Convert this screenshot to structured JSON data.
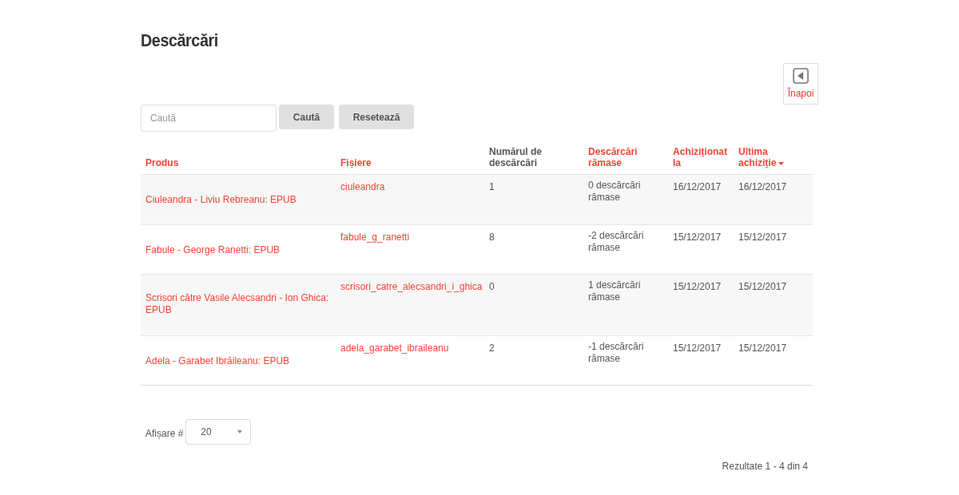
{
  "title": "Descărcări",
  "back_button": {
    "label": "Înapoi"
  },
  "search": {
    "placeholder": "Caută",
    "buttons": [
      "Caută",
      "Resetează"
    ]
  },
  "table": {
    "columns": [
      {
        "label": "Produs",
        "sortable": true,
        "sorted": false
      },
      {
        "label": "Fișiere",
        "sortable": true,
        "sorted": false
      },
      {
        "label": "Numărul de descărcări",
        "sortable": false,
        "sorted": false
      },
      {
        "label": "Descărcări rămase",
        "sortable": true,
        "sorted": false
      },
      {
        "label": "Achiziționat la",
        "sortable": true,
        "sorted": false
      },
      {
        "label": "Ultima achiziție",
        "sortable": true,
        "sorted": true
      }
    ],
    "rows": [
      [
        "Ciuleandra - Liviu Rebreanu: EPUB",
        "ciuleandra",
        "1",
        "0 descărcări rămase",
        "16/12/2017",
        "16/12/2017"
      ],
      [
        "Fabule - George Ranetti: EPUB",
        "fabule_g_ranetti",
        "8",
        "-2 descărcări rămase",
        "15/12/2017",
        "15/12/2017"
      ],
      [
        "Scrisori către Vasile Alecsandri - Ion Ghica: EPUB",
        "scrisori_catre_alecsandri_i_ghica",
        "0",
        "1 descărcări rămase",
        "15/12/2017",
        "15/12/2017"
      ],
      [
        "Adela - Garabet Ibrăileanu: EPUB",
        "adela_garabet_ibraileanu",
        "2",
        "-1 descărcări rămase",
        "15/12/2017",
        "15/12/2017"
      ]
    ]
  },
  "page_size": {
    "label": "Afișare #",
    "value": "20"
  },
  "results": "Rezultate 1 - 4 din 4"
}
